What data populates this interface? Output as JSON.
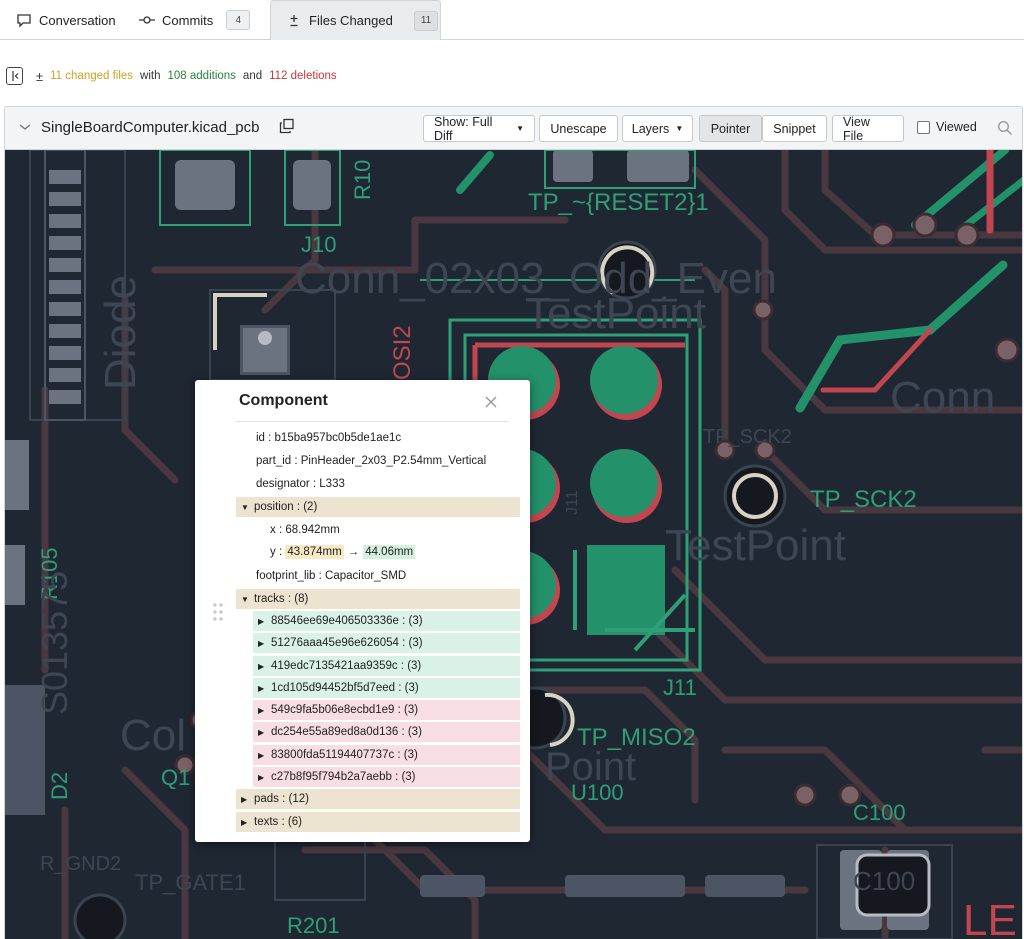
{
  "tabs": [
    {
      "label": "Conversation",
      "icon": "conversation-icon"
    },
    {
      "label": "Commits",
      "icon": "commit-icon",
      "count": "4"
    },
    {
      "label": "Files Changed",
      "icon": "diff-icon",
      "count": "11",
      "active": true
    }
  ],
  "summary": {
    "toggle_icon": "sidebar-toggle-icon",
    "pm_glyph": "±",
    "changed": "11 changed files",
    "with": "with",
    "additions": "108 additions",
    "and": "and",
    "deletions": "112 deletions"
  },
  "file": {
    "name": "SingleBoardComputer.kicad_pcb",
    "buttons": {
      "show": "Show: Full Diff",
      "unescape": "Unescape",
      "layers": "Layers",
      "pointer": "Pointer",
      "snippet": "Snippet",
      "view_file": "View File"
    },
    "viewed_label": "Viewed"
  },
  "pcb_labels": {
    "tp_reset2": "TP_~{RESET2}1",
    "j10": "J10",
    "r10": "R10",
    "conn": "Conn_02x03_Odd_Even",
    "testpoint1": "TestPoint",
    "osi2": "OSI2",
    "tp_sck2_ghost": "TP_SCK2",
    "tp_sck2": "TP_SCK2",
    "testpoint2": "TestPoint",
    "conn_right": "Conn",
    "j11": "J11",
    "j11_side": "J11",
    "tp_miso2": "TP_MISO2",
    "point": "Point",
    "u100": "U100",
    "c100": "C100",
    "c100_ghost": "C100",
    "r201": "R201",
    "tp_gate": "TP_GATE1",
    "gnd2": "R_GND2",
    "r105": "R105",
    "q1": "Q1",
    "d2": "D2",
    "diode": "Diode",
    "le": "LE",
    "col": "Col",
    "s_left": "S013575"
  },
  "panel": {
    "title": "Component",
    "id": "id : b15ba957bc0b5de1ae1c",
    "part_id": "part_id : PinHeader_2x03_P2.54mm_Vertical",
    "designator": "designator : L333",
    "position": "position : (2)",
    "x": "x : 68.942mm",
    "y_label": "y :",
    "y_old": "43.874mm",
    "y_arrow": "→",
    "y_new": "44.06mm",
    "footprint_lib": "footprint_lib : Capacitor_SMD",
    "tracks": "tracks : (8)",
    "track_items": [
      {
        "label": "88546ee69e406503336e : (3)",
        "state": "add"
      },
      {
        "label": "51276aaa45e96e626054 : (3)",
        "state": "add"
      },
      {
        "label": "419edc7135421aa9359c : (3)",
        "state": "add"
      },
      {
        "label": "1cd105d94452bf5d7eed : (3)",
        "state": "add"
      },
      {
        "label": "549c9fa5b06e8ecbd1e9 : (3)",
        "state": "del"
      },
      {
        "label": "dc254e55a89ed8a0d136 : (3)",
        "state": "del"
      },
      {
        "label": "83800fda51194407737c : (3)",
        "state": "del"
      },
      {
        "label": "c27b8f95f794b2a7aebb : (3)",
        "state": "del"
      }
    ],
    "pads": "pads : (12)",
    "texts": "texts : (6)"
  },
  "colors": {
    "board": "#1f2733",
    "trace": "#5a3940",
    "copper_green": "#23916a",
    "copper_red": "#c24650",
    "silk": "#2f9f78",
    "added_row": "#d9f1e6",
    "deleted_row": "#f7dde4",
    "changed_row": "#ece3d0"
  }
}
